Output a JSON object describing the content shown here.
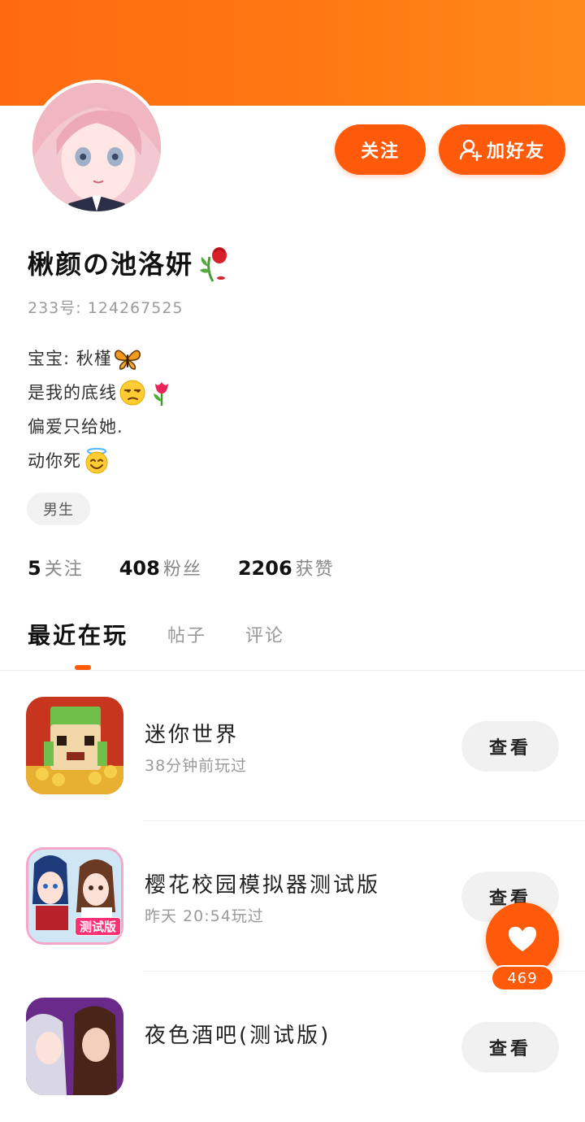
{
  "profile": {
    "nickname": "楸颜の池洛妍",
    "uid": "233号: 124267525",
    "bio": [
      {
        "text": "宝宝: 秋槿",
        "emoji": "butterfly-icon"
      },
      {
        "text": "是我的底线",
        "emoji": "unamused-face-icon",
        "emoji2": "tulip-icon"
      },
      {
        "text": "偏爱只给她.",
        "emoji": ""
      },
      {
        "text": "动你死",
        "emoji": "smiling-face-with-halo-icon"
      }
    ],
    "gender_tag": "男生"
  },
  "actions": {
    "follow_label": "关注",
    "add_friend_label": "加好友"
  },
  "stats": [
    {
      "num": "5",
      "label": "关注"
    },
    {
      "num": "408",
      "label": "粉丝"
    },
    {
      "num": "2206",
      "label": "获赞"
    }
  ],
  "tabs": [
    {
      "label": "最近在玩",
      "active": true
    },
    {
      "label": "帖子",
      "active": false
    },
    {
      "label": "评论",
      "active": false
    }
  ],
  "games": [
    {
      "title": "迷你世界",
      "subtitle": "38分钟前玩过",
      "button": "查看",
      "icon": "mini-world-icon"
    },
    {
      "title": "樱花校园模拟器测试版",
      "subtitle": "昨天 20:54玩过",
      "button": "查看",
      "icon": "sakura-school-icon",
      "icon_badge": "测试版"
    },
    {
      "title": "夜色酒吧(测试版)",
      "subtitle": "",
      "button": "查看",
      "icon": "night-bar-icon"
    }
  ],
  "like_fab": {
    "count": "469"
  },
  "colors": {
    "accent": "#ff5a0a",
    "banner": "#ff7a12"
  }
}
